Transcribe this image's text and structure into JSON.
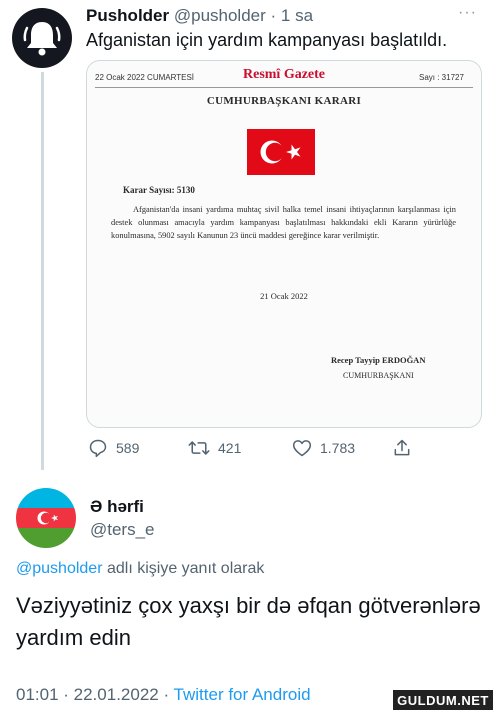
{
  "tweet1": {
    "display_name": "Pusholder",
    "handle_time": "@pusholder · 1 sa",
    "more": "···",
    "text": "Afganistan için yardım kampanyası başlatıldı.",
    "document": {
      "date": "22 Ocak 2022 CUMARTESİ",
      "masthead": "Resmî Gazete",
      "issue": "Sayı : 31727",
      "title": "CUMHURBAŞKANI KARARI",
      "decision_no": "Karar Sayısı: 5130",
      "body": "Afganistan'da insani yardıma muhtaç sivil halka temel insani ihtiyaçlarının karşılanması için destek olunması amacıyla yardım kampanyası başlatılması hakkındaki ekli Kararın yürürlüğe konulmasına, 5902 sayılı Kanunun 23 üncü maddesi gereğince karar verilmiştir.",
      "sign_date": "21 Ocak 2022",
      "signer": "Recep Tayyip ERDOĞAN",
      "signer_title": "CUMHURBAŞKANI"
    },
    "actions": {
      "replies": "589",
      "retweets": "421",
      "likes": "1.783"
    }
  },
  "tweet2": {
    "display_name": "Ə hərfi",
    "handle": "@ters_e",
    "reply_mention": "@pusholder",
    "reply_suffix": " adlı kişiye yanıt olarak",
    "text": "Vəziyyətiniz çox yaxşı bir də əfqan götverənlərə yardım edin",
    "meta_time": "01:01 · 22.01.2022 · ",
    "meta_source": "Twitter for Android"
  },
  "watermark": "GULDUM.NET",
  "colors": {
    "link": "#1d9bf0",
    "turkish_red": "#e30a17",
    "az_blue": "#00b5e2",
    "az_red": "#ef3340",
    "az_green": "#509e2f"
  }
}
